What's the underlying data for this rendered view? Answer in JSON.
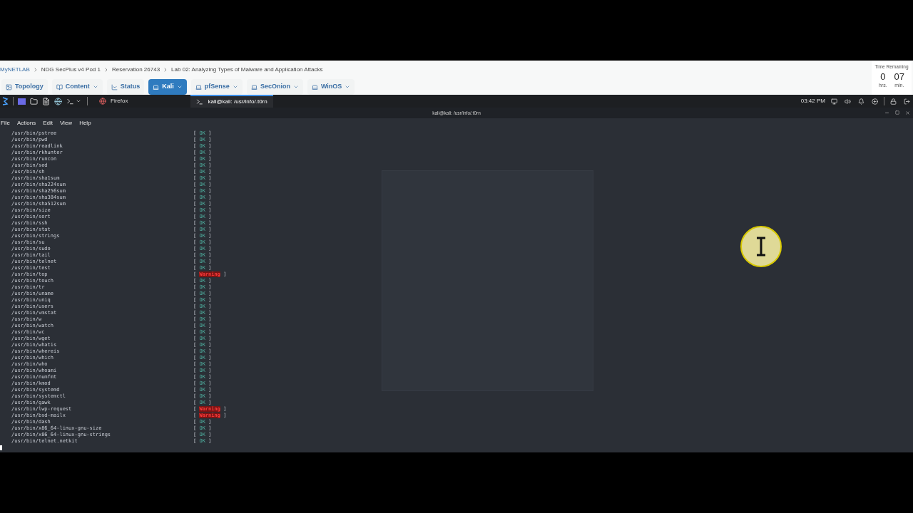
{
  "breadcrumb": [
    "MyNETLAB",
    "NDG SecPlus v4 Pod 1",
    "Reservation 26743",
    "Lab 02: Analyzing Types of Malware and Application Attacks"
  ],
  "nav_tabs": [
    {
      "label": "Topology",
      "kind": "topology",
      "has_menu": false,
      "selected": false
    },
    {
      "label": "Content",
      "kind": "content",
      "has_menu": true,
      "selected": false
    },
    {
      "label": "Status",
      "kind": "status",
      "has_menu": false,
      "selected": false
    },
    {
      "label": "Kali",
      "kind": "machine",
      "has_menu": true,
      "selected": true
    },
    {
      "label": "pfSense",
      "kind": "machine",
      "has_menu": true,
      "selected": false
    },
    {
      "label": "SecOnion",
      "kind": "machine",
      "has_menu": true,
      "selected": false
    },
    {
      "label": "WinOS",
      "kind": "machine",
      "has_menu": true,
      "selected": false
    }
  ],
  "timer": {
    "title": "Time Remaining",
    "hours": "0",
    "hours_unit": "hrs.",
    "minutes": "07",
    "minutes_unit": "min."
  },
  "taskbar": {
    "apps": [
      {
        "label": "Firefox",
        "kind": "browser",
        "selected": false
      },
      {
        "label": "kali@kali: /usr/info/.t0rn",
        "kind": "terminal",
        "selected": true
      }
    ],
    "clock": "03:42 PM"
  },
  "terminal": {
    "title": "kali@kali: /usr/info/.t0rn",
    "menu": [
      "File",
      "Actions",
      "Edit",
      "View",
      "Help"
    ],
    "rows": [
      {
        "path": "/usr/bin/pstree",
        "status": "[ OK ]",
        "kind": "ok"
      },
      {
        "path": "/usr/bin/pwd",
        "status": "[ OK ]",
        "kind": "ok"
      },
      {
        "path": "/usr/bin/readlink",
        "status": "[ OK ]",
        "kind": "ok"
      },
      {
        "path": "/usr/bin/rkhunter",
        "status": "[ OK ]",
        "kind": "ok"
      },
      {
        "path": "/usr/bin/runcon",
        "status": "[ OK ]",
        "kind": "ok"
      },
      {
        "path": "/usr/bin/sed",
        "status": "[ OK ]",
        "kind": "ok"
      },
      {
        "path": "/usr/bin/sh",
        "status": "[ OK ]",
        "kind": "ok"
      },
      {
        "path": "/usr/bin/sha1sum",
        "status": "[ OK ]",
        "kind": "ok"
      },
      {
        "path": "/usr/bin/sha224sum",
        "status": "[ OK ]",
        "kind": "ok"
      },
      {
        "path": "/usr/bin/sha256sum",
        "status": "[ OK ]",
        "kind": "ok"
      },
      {
        "path": "/usr/bin/sha384sum",
        "status": "[ OK ]",
        "kind": "ok"
      },
      {
        "path": "/usr/bin/sha512sum",
        "status": "[ OK ]",
        "kind": "ok"
      },
      {
        "path": "/usr/bin/size",
        "status": "[ OK ]",
        "kind": "ok"
      },
      {
        "path": "/usr/bin/sort",
        "status": "[ OK ]",
        "kind": "ok"
      },
      {
        "path": "/usr/bin/ssh",
        "status": "[ OK ]",
        "kind": "ok"
      },
      {
        "path": "/usr/bin/stat",
        "status": "[ OK ]",
        "kind": "ok"
      },
      {
        "path": "/usr/bin/strings",
        "status": "[ OK ]",
        "kind": "ok"
      },
      {
        "path": "/usr/bin/su",
        "status": "[ OK ]",
        "kind": "ok"
      },
      {
        "path": "/usr/bin/sudo",
        "status": "[ OK ]",
        "kind": "ok"
      },
      {
        "path": "/usr/bin/tail",
        "status": "[ OK ]",
        "kind": "ok"
      },
      {
        "path": "/usr/bin/telnet",
        "status": "[ OK ]",
        "kind": "ok"
      },
      {
        "path": "/usr/bin/test",
        "status": "[ OK ]",
        "kind": "ok"
      },
      {
        "path": "/usr/bin/top",
        "status": "[ Warning ]",
        "kind": "warning"
      },
      {
        "path": "/usr/bin/touch",
        "status": "[ OK ]",
        "kind": "ok"
      },
      {
        "path": "/usr/bin/tr",
        "status": "[ OK ]",
        "kind": "ok"
      },
      {
        "path": "/usr/bin/uname",
        "status": "[ OK ]",
        "kind": "ok"
      },
      {
        "path": "/usr/bin/uniq",
        "status": "[ OK ]",
        "kind": "ok"
      },
      {
        "path": "/usr/bin/users",
        "status": "[ OK ]",
        "kind": "ok"
      },
      {
        "path": "/usr/bin/vmstat",
        "status": "[ OK ]",
        "kind": "ok"
      },
      {
        "path": "/usr/bin/w",
        "status": "[ OK ]",
        "kind": "ok"
      },
      {
        "path": "/usr/bin/watch",
        "status": "[ OK ]",
        "kind": "ok"
      },
      {
        "path": "/usr/bin/wc",
        "status": "[ OK ]",
        "kind": "ok"
      },
      {
        "path": "/usr/bin/wget",
        "status": "[ OK ]",
        "kind": "ok"
      },
      {
        "path": "/usr/bin/whatis",
        "status": "[ OK ]",
        "kind": "ok"
      },
      {
        "path": "/usr/bin/whereis",
        "status": "[ OK ]",
        "kind": "ok"
      },
      {
        "path": "/usr/bin/which",
        "status": "[ OK ]",
        "kind": "ok"
      },
      {
        "path": "/usr/bin/who",
        "status": "[ OK ]",
        "kind": "ok"
      },
      {
        "path": "/usr/bin/whoami",
        "status": "[ OK ]",
        "kind": "ok"
      },
      {
        "path": "/usr/bin/numfmt",
        "status": "[ OK ]",
        "kind": "ok"
      },
      {
        "path": "/usr/bin/kmod",
        "status": "[ OK ]",
        "kind": "ok"
      },
      {
        "path": "/usr/bin/systemd",
        "status": "[ OK ]",
        "kind": "ok"
      },
      {
        "path": "/usr/bin/systemctl",
        "status": "[ OK ]",
        "kind": "ok"
      },
      {
        "path": "/usr/bin/gawk",
        "status": "[ OK ]",
        "kind": "ok"
      },
      {
        "path": "/usr/bin/lwp-request",
        "status": "[ Warning ]",
        "kind": "warning"
      },
      {
        "path": "/usr/bin/bsd-mailx",
        "status": "[ Warning ]",
        "kind": "warning"
      },
      {
        "path": "/usr/bin/dash",
        "status": "[ OK ]",
        "kind": "ok"
      },
      {
        "path": "/usr/bin/x86_64-linux-gnu-size",
        "status": "[ OK ]",
        "kind": "ok"
      },
      {
        "path": "/usr/bin/x86_64-linux-gnu-strings",
        "status": "[ OK ]",
        "kind": "ok"
      },
      {
        "path": "/usr/bin/telnet.netkit",
        "status": "[ OK ]",
        "kind": "ok"
      }
    ]
  }
}
